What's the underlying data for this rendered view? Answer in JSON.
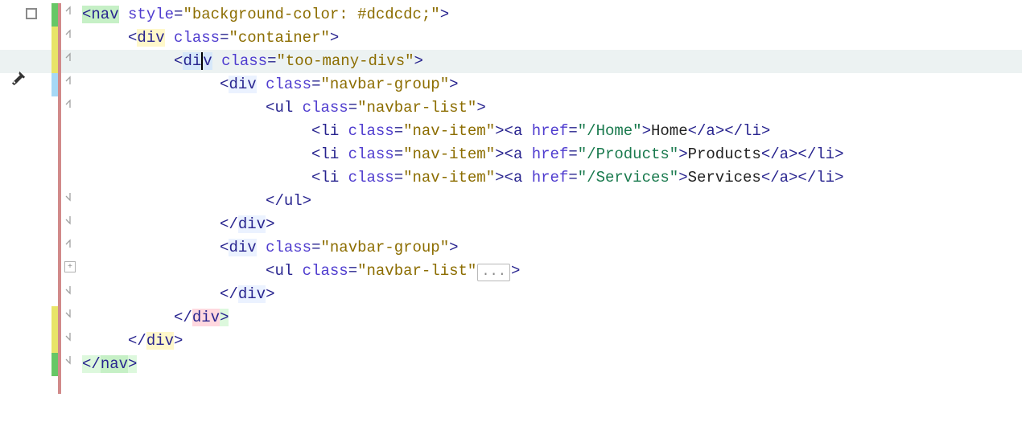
{
  "lines": [
    {
      "indent": 0,
      "segments": [
        {
          "t": "tag",
          "v": "<",
          "bg": "bg-add"
        },
        {
          "t": "tag",
          "v": "nav",
          "bg": "bg-add"
        },
        {
          "t": "txt",
          "v": " "
        },
        {
          "t": "attr",
          "v": "style"
        },
        {
          "t": "tag",
          "v": "="
        },
        {
          "t": "str",
          "v": "\"background-color: #dcdcdc;\""
        },
        {
          "t": "tag",
          "v": ">"
        }
      ],
      "fold": "open-down",
      "strip": "#66c766"
    },
    {
      "indent": 1,
      "segments": [
        {
          "t": "tag",
          "v": "<"
        },
        {
          "t": "tag",
          "v": "div",
          "bg": "bg-yel"
        },
        {
          "t": "txt",
          "v": " "
        },
        {
          "t": "attr",
          "v": "class"
        },
        {
          "t": "tag",
          "v": "="
        },
        {
          "t": "str",
          "v": "\"container\""
        },
        {
          "t": "tag",
          "v": ">"
        }
      ],
      "fold": "open-down",
      "strip": "#e8e468"
    },
    {
      "indent": 2,
      "current": true,
      "segments": [
        {
          "t": "tag",
          "v": "<"
        },
        {
          "t": "tag",
          "v": "di",
          "bg": "bg-mod"
        },
        {
          "caret": true
        },
        {
          "t": "tag",
          "v": "v",
          "bg": "bg-mod"
        },
        {
          "t": "txt",
          "v": " "
        },
        {
          "t": "attr",
          "v": "class"
        },
        {
          "t": "tag",
          "v": "="
        },
        {
          "t": "str",
          "v": "\"too-many-divs\""
        },
        {
          "t": "tag",
          "v": ">"
        }
      ],
      "fold": "open-down",
      "strip": "#e8e468"
    },
    {
      "indent": 3,
      "segments": [
        {
          "t": "tag",
          "v": "<"
        },
        {
          "t": "tag",
          "v": "div",
          "bg": "bg-mod2"
        },
        {
          "t": "txt",
          "v": " "
        },
        {
          "t": "attr",
          "v": "class"
        },
        {
          "t": "tag",
          "v": "="
        },
        {
          "t": "str",
          "v": "\"navbar-group\""
        },
        {
          "t": "tag",
          "v": ">"
        }
      ],
      "fold": "open-down",
      "strip": "#a6d8f5"
    },
    {
      "indent": 4,
      "segments": [
        {
          "t": "tag",
          "v": "<"
        },
        {
          "t": "tag",
          "v": "ul"
        },
        {
          "t": "txt",
          "v": " "
        },
        {
          "t": "attr",
          "v": "class"
        },
        {
          "t": "tag",
          "v": "="
        },
        {
          "t": "str",
          "v": "\"navbar-list\""
        },
        {
          "t": "tag",
          "v": ">"
        }
      ],
      "fold": "open-down"
    },
    {
      "indent": 5,
      "segments": [
        {
          "t": "tag",
          "v": "<"
        },
        {
          "t": "tag",
          "v": "li"
        },
        {
          "t": "txt",
          "v": " "
        },
        {
          "t": "attr",
          "v": "class"
        },
        {
          "t": "tag",
          "v": "="
        },
        {
          "t": "str",
          "v": "\"nav-item\""
        },
        {
          "t": "tag",
          "v": "><"
        },
        {
          "t": "tag",
          "v": "a"
        },
        {
          "t": "txt",
          "v": " "
        },
        {
          "t": "attr",
          "v": "href"
        },
        {
          "t": "tag",
          "v": "="
        },
        {
          "t": "val",
          "v": "\"/Home\""
        },
        {
          "t": "tag",
          "v": ">"
        },
        {
          "t": "txt",
          "v": "Home"
        },
        {
          "t": "tag",
          "v": "</"
        },
        {
          "t": "tag",
          "v": "a"
        },
        {
          "t": "tag",
          "v": "></"
        },
        {
          "t": "tag",
          "v": "li"
        },
        {
          "t": "tag",
          "v": ">"
        }
      ]
    },
    {
      "indent": 5,
      "segments": [
        {
          "t": "tag",
          "v": "<"
        },
        {
          "t": "tag",
          "v": "li"
        },
        {
          "t": "txt",
          "v": " "
        },
        {
          "t": "attr",
          "v": "class"
        },
        {
          "t": "tag",
          "v": "="
        },
        {
          "t": "str",
          "v": "\"nav-item\""
        },
        {
          "t": "tag",
          "v": "><"
        },
        {
          "t": "tag",
          "v": "a"
        },
        {
          "t": "txt",
          "v": " "
        },
        {
          "t": "attr",
          "v": "href"
        },
        {
          "t": "tag",
          "v": "="
        },
        {
          "t": "val",
          "v": "\"/Products\""
        },
        {
          "t": "tag",
          "v": ">"
        },
        {
          "t": "txt",
          "v": "Products"
        },
        {
          "t": "tag",
          "v": "</"
        },
        {
          "t": "tag",
          "v": "a"
        },
        {
          "t": "tag",
          "v": "></"
        },
        {
          "t": "tag",
          "v": "li"
        },
        {
          "t": "tag",
          "v": ">"
        }
      ]
    },
    {
      "indent": 5,
      "segments": [
        {
          "t": "tag",
          "v": "<"
        },
        {
          "t": "tag",
          "v": "li"
        },
        {
          "t": "txt",
          "v": " "
        },
        {
          "t": "attr",
          "v": "class"
        },
        {
          "t": "tag",
          "v": "="
        },
        {
          "t": "str",
          "v": "\"nav-item\""
        },
        {
          "t": "tag",
          "v": "><"
        },
        {
          "t": "tag",
          "v": "a"
        },
        {
          "t": "txt",
          "v": " "
        },
        {
          "t": "attr",
          "v": "href"
        },
        {
          "t": "tag",
          "v": "="
        },
        {
          "t": "val",
          "v": "\"/Services\""
        },
        {
          "t": "tag",
          "v": ">"
        },
        {
          "t": "txt",
          "v": "Services"
        },
        {
          "t": "tag",
          "v": "</"
        },
        {
          "t": "tag",
          "v": "a"
        },
        {
          "t": "tag",
          "v": "></"
        },
        {
          "t": "tag",
          "v": "li"
        },
        {
          "t": "tag",
          "v": ">"
        }
      ]
    },
    {
      "indent": 4,
      "segments": [
        {
          "t": "tag",
          "v": "</"
        },
        {
          "t": "tag",
          "v": "ul"
        },
        {
          "t": "tag",
          "v": ">"
        }
      ],
      "fold": "close"
    },
    {
      "indent": 3,
      "segments": [
        {
          "t": "tag",
          "v": "</"
        },
        {
          "t": "tag",
          "v": "div",
          "bg": "bg-mod2"
        },
        {
          "t": "tag",
          "v": ">"
        }
      ],
      "fold": "close"
    },
    {
      "indent": 3,
      "segments": [
        {
          "t": "tag",
          "v": "<"
        },
        {
          "t": "tag",
          "v": "div",
          "bg": "bg-mod2"
        },
        {
          "t": "txt",
          "v": " "
        },
        {
          "t": "attr",
          "v": "class"
        },
        {
          "t": "tag",
          "v": "="
        },
        {
          "t": "str",
          "v": "\"navbar-group\""
        },
        {
          "t": "tag",
          "v": ">"
        }
      ],
      "fold": "open-down"
    },
    {
      "indent": 4,
      "segments": [
        {
          "t": "tag",
          "v": "<"
        },
        {
          "t": "tag",
          "v": "ul"
        },
        {
          "t": "txt",
          "v": " "
        },
        {
          "t": "attr",
          "v": "class"
        },
        {
          "t": "tag",
          "v": "="
        },
        {
          "t": "str",
          "v": "\"navbar-list\""
        },
        {
          "folded": "..."
        },
        {
          "t": "tag",
          "v": ">"
        }
      ],
      "fold": "open-plus"
    },
    {
      "indent": 3,
      "segments": [
        {
          "t": "tag",
          "v": "</"
        },
        {
          "t": "tag",
          "v": "div",
          "bg": "bg-mod2"
        },
        {
          "t": "tag",
          "v": ">"
        }
      ],
      "fold": "close"
    },
    {
      "indent": 2,
      "segments": [
        {
          "t": "tag",
          "v": "</"
        },
        {
          "t": "tag",
          "v": "div",
          "bg": "bg-del"
        },
        {
          "t": "tag",
          "v": ">",
          "bg": "bg-add2"
        }
      ],
      "fold": "close",
      "strip": "#e8e468"
    },
    {
      "indent": 1,
      "segments": [
        {
          "t": "tag",
          "v": "</"
        },
        {
          "t": "tag",
          "v": "div",
          "bg": "bg-yel"
        },
        {
          "t": "tag",
          "v": ">"
        }
      ],
      "fold": "close",
      "strip": "#e8e468"
    },
    {
      "indent": 0,
      "segments": [
        {
          "t": "tag",
          "v": "</",
          "bg": "bg-add2"
        },
        {
          "t": "tag",
          "v": "nav",
          "bg": "bg-add"
        },
        {
          "t": "tag",
          "v": ">",
          "bg": "bg-add2"
        }
      ],
      "fold": "close",
      "strip": "#66c766"
    }
  ],
  "folded_placeholder": "...",
  "indent_unit": "     "
}
